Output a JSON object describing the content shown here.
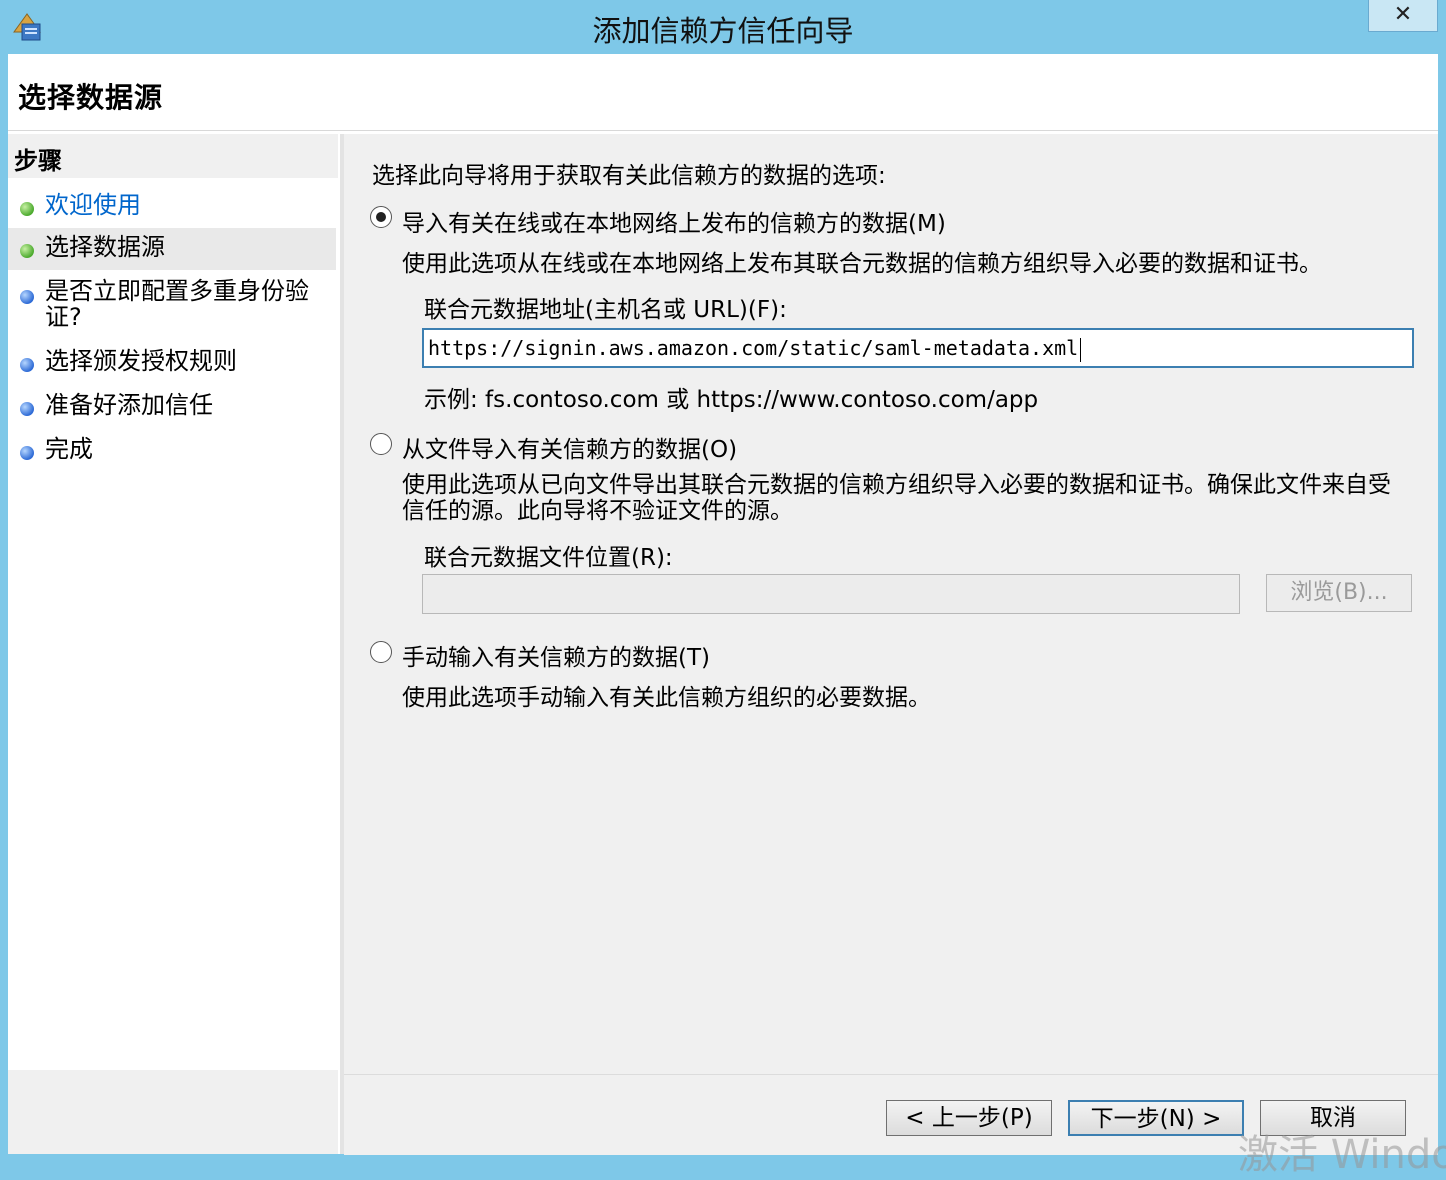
{
  "window": {
    "title": "添加信赖方信任向导",
    "close_label": "✕",
    "app_icon": "adfs-wizard-icon"
  },
  "header": {
    "title": "选择数据源"
  },
  "steps": {
    "heading": "步骤",
    "items": [
      {
        "label": "欢迎使用",
        "status": "complete",
        "link": true
      },
      {
        "label": "选择数据源",
        "status": "current",
        "link": false
      },
      {
        "label": "是否立即配置多重身份验证?",
        "status": "pending",
        "link": false
      },
      {
        "label": "选择颁发授权规则",
        "status": "pending",
        "link": false
      },
      {
        "label": "准备好添加信任",
        "status": "pending",
        "link": false
      },
      {
        "label": "完成",
        "status": "pending",
        "link": false
      }
    ],
    "colors": {
      "complete": "#4caa2e",
      "pending": "#2e6bd6",
      "link": "#0066cc"
    }
  },
  "main": {
    "intro": "选择此向导将用于获取有关此信赖方的数据的选项:",
    "option_online": {
      "label": "导入有关在线或在本地网络上发布的信赖方的数据(M)",
      "selected": true,
      "description": "使用此选项从在线或在本地网络上发布其联合元数据的信赖方组织导入必要的数据和证书。",
      "address_label": "联合元数据地址(主机名或 URL)(F):",
      "address_value": "https://signin.aws.amazon.com/static/saml-metadata.xml",
      "example": "示例: fs.contoso.com 或 https://www.contoso.com/app"
    },
    "option_file": {
      "label": "从文件导入有关信赖方的数据(O)",
      "selected": false,
      "description": "使用此选项从已向文件导出其联合元数据的信赖方组织导入必要的数据和证书。确保此文件来自受信任的源。此向导将不验证文件的源。",
      "location_label": "联合元数据文件位置(R):",
      "location_value": "",
      "browse_label": "浏览(B)..."
    },
    "option_manual": {
      "label": "手动输入有关信赖方的数据(T)",
      "selected": false,
      "description": "使用此选项手动输入有关此信赖方组织的必要数据。"
    }
  },
  "footer": {
    "back_label": "< 上一步(P)",
    "next_label": "下一步(N) >",
    "cancel_label": "取消"
  },
  "watermark": "激活 Windo"
}
